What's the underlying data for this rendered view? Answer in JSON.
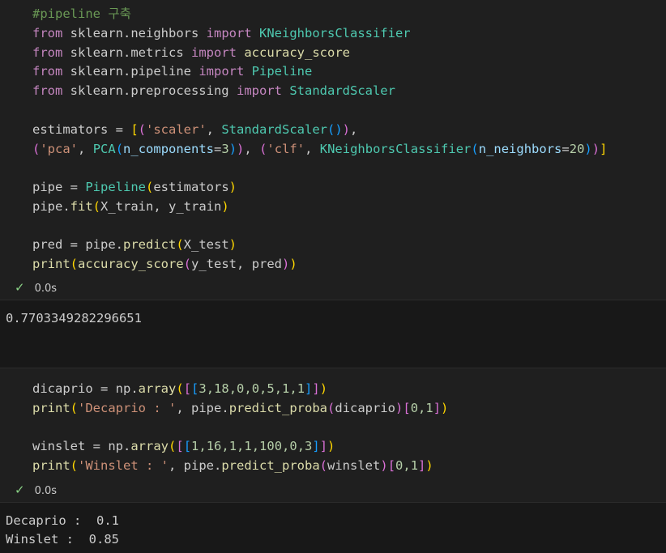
{
  "cell1": {
    "comment": "#pipeline 구축",
    "imports": [
      {
        "from": "from",
        "module": "sklearn.neighbors",
        "import": "import",
        "name": "KNeighborsClassifier"
      },
      {
        "from": "from",
        "module": "sklearn.metrics",
        "import": "import",
        "name": "accuracy_score"
      },
      {
        "from": "from",
        "module": "sklearn.pipeline",
        "import": "import",
        "name": "Pipeline"
      },
      {
        "from": "from",
        "module": "sklearn.preprocessing",
        "import": "import",
        "name": "StandardScaler"
      }
    ],
    "estimators_var": "estimators",
    "scaler_str": "'scaler'",
    "scaler_cls": "StandardScaler",
    "pca_str": "'pca'",
    "pca_cls": "PCA",
    "pca_param": "n_components",
    "pca_val": "3",
    "clf_str": "'clf'",
    "clf_cls": "KNeighborsClassifier",
    "clf_param": "n_neighbors",
    "clf_val": "20",
    "pipe_var": "pipe",
    "pipeline_cls": "Pipeline",
    "fit_call": "fit",
    "x_train": "X_train",
    "y_train": "y_train",
    "pred_var": "pred",
    "predict_call": "predict",
    "x_test": "X_test",
    "print_fn": "print",
    "acc_fn": "accuracy_score",
    "y_test": "y_test",
    "status_time": "0.0s"
  },
  "output1": {
    "value": "0.7703349282296651"
  },
  "cell2": {
    "dicaprio_var": "dicaprio",
    "np": "np",
    "array_fn": "array",
    "dicaprio_vals": "3,18,0,0,5,1,1",
    "decaprio_str": "'Decaprio : '",
    "proba_fn": "predict_proba",
    "index": "0,1",
    "winslet_var": "winslet",
    "winslet_vals": "1,16,1,1,100,0,3",
    "winslet_str": "'Winslet : '",
    "status_time": "0.0s"
  },
  "output2": {
    "line1": "Decaprio :  0.1",
    "line2": "Winslet :  0.85"
  },
  "colors": {
    "background": "#1f1f1f",
    "keyword": "#c586c0",
    "function": "#dcdcaa",
    "class": "#4ec9b0",
    "string": "#ce9178",
    "number": "#b5cea8",
    "param": "#9cdcfe",
    "comment": "#6a9955",
    "check": "#89d185"
  }
}
